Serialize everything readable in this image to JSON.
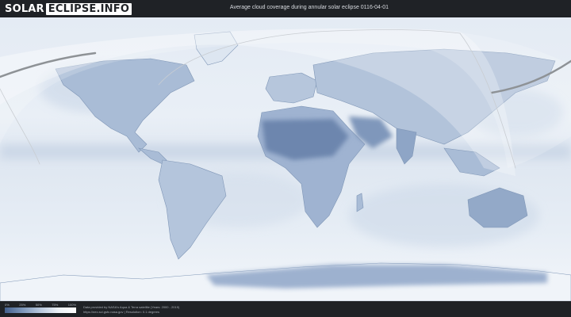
{
  "logo": {
    "part1": "SOLAR",
    "part2": "ECLIPSE.INFO"
  },
  "title": "Average cloud coverage during annular solar eclipse 0116-04-01",
  "legend": {
    "ticks": [
      "0%",
      "25%",
      "50%",
      "75%",
      "100%"
    ]
  },
  "credits": {
    "line1": "Data provided by NASA's Aqua & Terra satellite (Years: 2000 - 2019)",
    "line2": "https://neo.sci.gsfc.nasa.gov | Resolution: 0.1 degrees"
  },
  "colors": {
    "clear": "#ffffff",
    "cloud_low": "#44618e",
    "background": "#1f2226",
    "path": "#808080"
  }
}
